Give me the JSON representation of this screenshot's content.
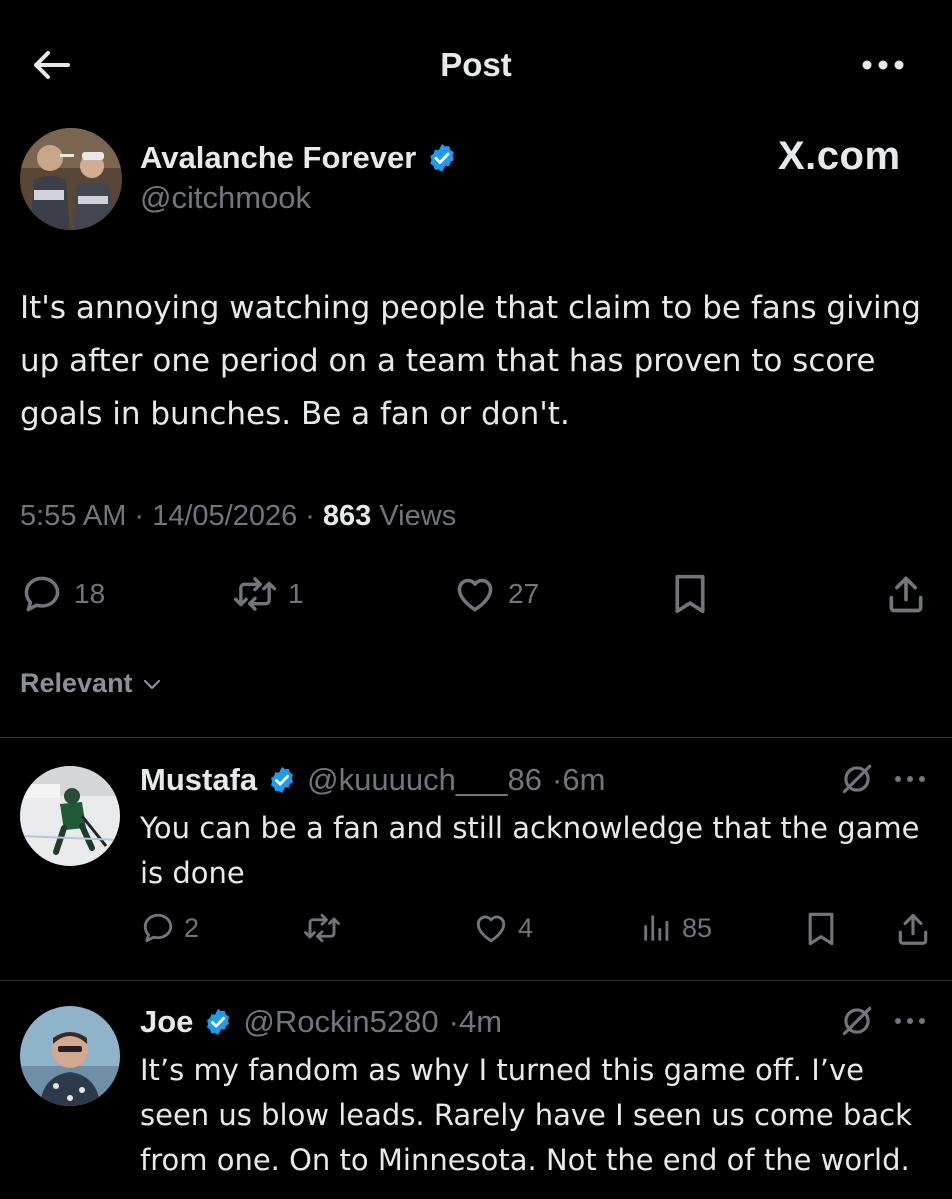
{
  "header": {
    "title": "Post"
  },
  "post": {
    "author_name": "Avalanche Forever",
    "author_handle": "@citchmook",
    "brand": "X.com",
    "text": "It's annoying watching people that claim to be fans giving up after one period on a team that has proven to score goals in bunches. Be a fan or don't.",
    "time": "5:55 AM",
    "date": "14/05/2026",
    "views_count": "863",
    "views_label": "Views",
    "replies": "18",
    "reposts": "1",
    "likes": "27"
  },
  "sort": {
    "label": "Relevant"
  },
  "replies": [
    {
      "name": "Mustafa",
      "handle": "@kuuuuch___86",
      "time": "6m",
      "text": "You can be a fan and still acknowledge that the game is done",
      "replies": "2",
      "likes": "4",
      "views": "85"
    },
    {
      "name": "Joe",
      "handle": "@Rockin5280",
      "time": "4m",
      "text": "It’s my fandom as why I turned this game off. I’ve seen us blow leads. Rarely have I seen us come back from one. On to Minnesota. Not the end of the world."
    }
  ],
  "colors": {
    "verified": "#1d9bf0",
    "muted": "#71767b",
    "background": "#000000"
  }
}
